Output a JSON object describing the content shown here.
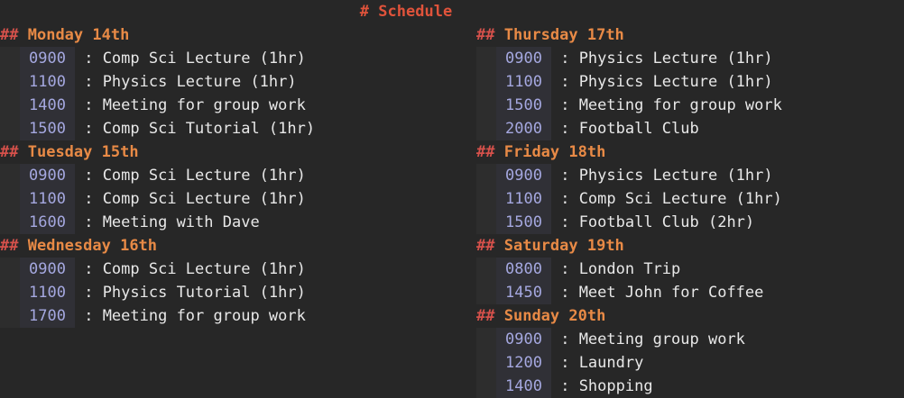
{
  "title": {
    "hash": "#",
    "text": "Schedule"
  },
  "header_marker": "##",
  "separator": ":",
  "left_days": [
    {
      "day": "Monday 14th",
      "entries": [
        {
          "time": "0900",
          "task": "Comp Sci Lecture (1hr)"
        },
        {
          "time": "1100",
          "task": "Physics Lecture (1hr)"
        },
        {
          "time": "1400",
          "task": "Meeting for group work"
        },
        {
          "time": "1500",
          "task": "Comp Sci Tutorial (1hr)"
        }
      ]
    },
    {
      "day": "Tuesday 15th",
      "entries": [
        {
          "time": "0900",
          "task": "Comp Sci Lecture (1hr)"
        },
        {
          "time": "1100",
          "task": "Comp Sci Lecture (1hr)"
        },
        {
          "time": "1600",
          "task": "Meeting with Dave"
        }
      ]
    },
    {
      "day": "Wednesday 16th",
      "entries": [
        {
          "time": "0900",
          "task": "Comp Sci Lecture (1hr)"
        },
        {
          "time": "1100",
          "task": "Physics Tutorial (1hr)"
        },
        {
          "time": "1700",
          "task": "Meeting for group work"
        }
      ]
    }
  ],
  "right_days": [
    {
      "day": "Thursday 17th",
      "entries": [
        {
          "time": "0900",
          "task": "Physics Lecture (1hr)"
        },
        {
          "time": "1100",
          "task": "Physics Lecture (1hr)"
        },
        {
          "time": "1500",
          "task": "Meeting for group work"
        },
        {
          "time": "2000",
          "task": "Football Club"
        }
      ]
    },
    {
      "day": "Friday 18th",
      "entries": [
        {
          "time": "0900",
          "task": "Physics Lecture (1hr)"
        },
        {
          "time": "1100",
          "task": "Comp Sci Lecture (1hr)"
        },
        {
          "time": "1500",
          "task": "Football Club (2hr)"
        }
      ]
    },
    {
      "day": "Saturday 19th",
      "entries": [
        {
          "time": "0800",
          "task": "London Trip"
        },
        {
          "time": "1450",
          "task": "Meet John for Coffee"
        }
      ]
    },
    {
      "day": "Sunday 20th",
      "entries": [
        {
          "time": "0900",
          "task": "Meeting group work"
        },
        {
          "time": "1200",
          "task": "Laundry"
        },
        {
          "time": "1400",
          "task": "Shopping"
        }
      ]
    }
  ]
}
